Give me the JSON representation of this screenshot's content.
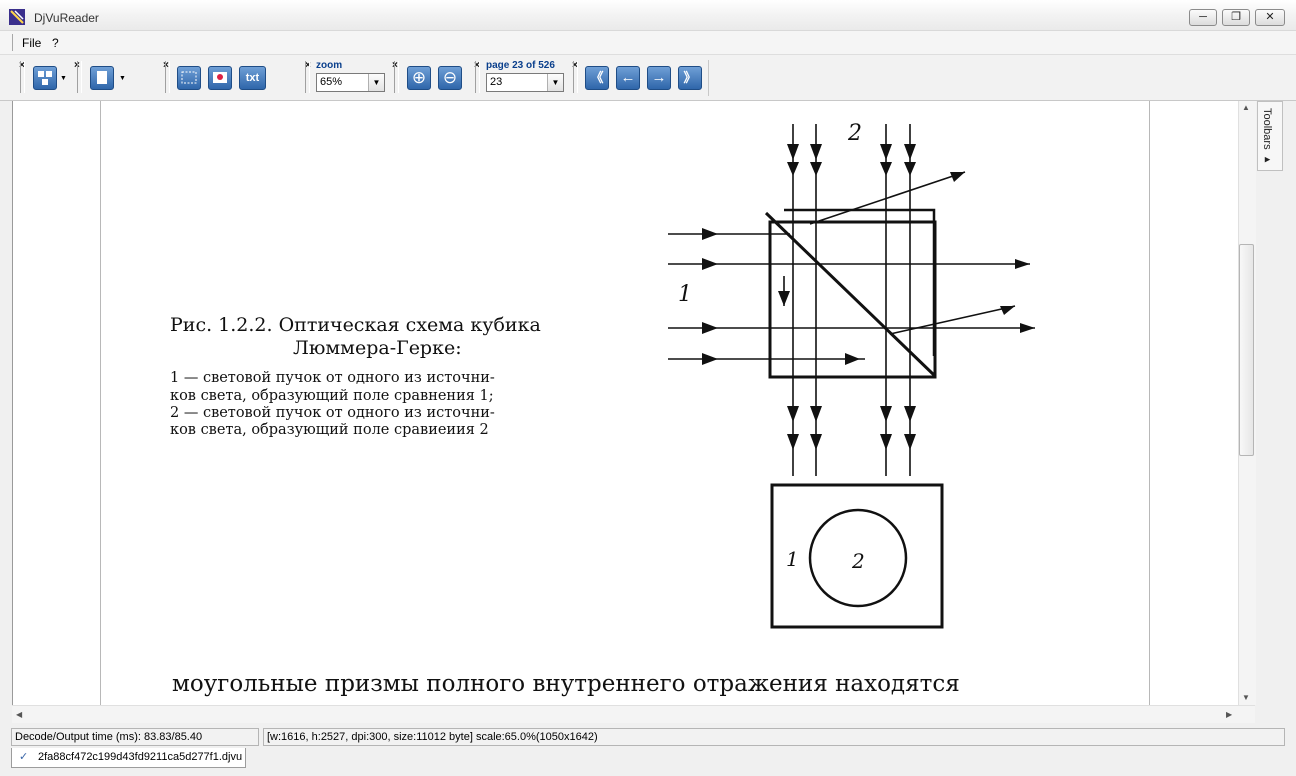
{
  "window": {
    "title": "DjVuReader",
    "min": "─",
    "restore": "❐",
    "close": "✕"
  },
  "menu": {
    "file": "File",
    "help": "?"
  },
  "toolbar": {
    "zoom_label": "zoom",
    "zoom_value": "65%",
    "page_label": "page 23 of 526",
    "page_value": "23",
    "close_glyph": "×",
    "txt_label": "txt",
    "zoom_in": "⊕",
    "zoom_out": "⊖",
    "first": "《",
    "prev": "←",
    "next": "→",
    "last": "》",
    "icons": [
      "layout-icon",
      "page-icon",
      "select-rect-icon",
      "image-icon",
      "text-icon",
      "zoom-in-icon",
      "zoom-out-icon",
      "first-page-icon",
      "prev-page-icon",
      "next-page-icon",
      "last-page-icon"
    ]
  },
  "side_tab": {
    "label": "Toolbars ▸"
  },
  "document": {
    "caption_title": "Рис. 1.2.2. Оптическая схема кубика",
    "caption_title2": "Люммера-Герке:",
    "caption_l1": "1 — световой пучок от одного из источни-",
    "caption_l2": "ков света, образующий поле сравнения 1;",
    "caption_l3": "2 — световой пучок от одного из источни-",
    "caption_l4": "ков света, образующий поле сравиеиия 2",
    "fig_label_top": "2",
    "fig_label_left": "1",
    "fig_field_1": "1",
    "fig_field_2": "2",
    "body_line": "моугольные призмы полного внутреннего отражения находятся"
  },
  "status": {
    "decode": "Decode/Output time (ms): 83.83/85.40",
    "info": "[w:1616, h:2527, dpi:300, size:11012 byte] scale:65.0%(1050x1642)"
  },
  "tab": {
    "filename": "2fa88cf472c199d43fd9211ca5d277f1.djvu"
  }
}
